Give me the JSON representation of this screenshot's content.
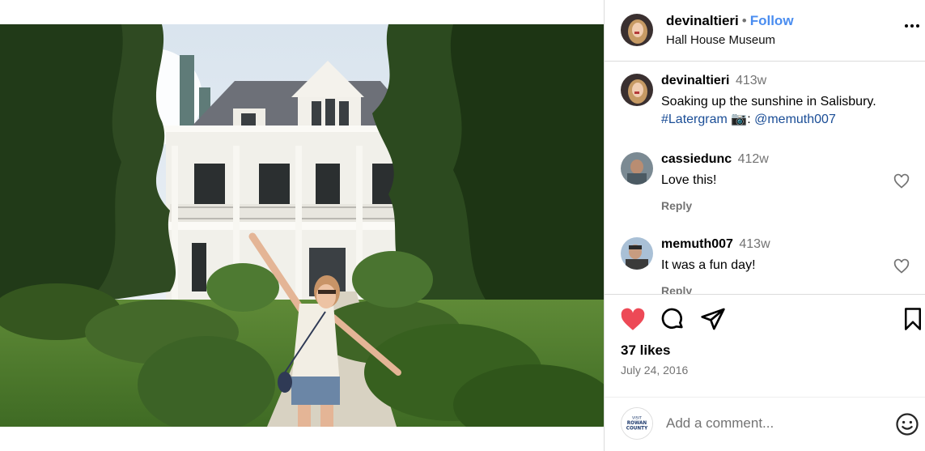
{
  "post": {
    "author": "devinaltieri",
    "follow_label": "Follow",
    "location": "Hall House Museum",
    "more_icon": "more-horizontal-icon"
  },
  "comments": [
    {
      "user": "devinaltieri",
      "time": "413w",
      "text_main": "Soaking up the sunshine in Salisbury.",
      "hashtag": "#Latergram",
      "camera_emoji": "📷",
      "colon": ":",
      "mention": "@memuth007",
      "is_caption": true
    },
    {
      "user": "cassiedunc",
      "time": "412w",
      "text": "Love this!",
      "reply": "Reply"
    },
    {
      "user": "memuth007",
      "time": "413w",
      "text": "It was a fun day!",
      "reply": "Reply"
    }
  ],
  "actions": {
    "icons": [
      "heart-filled-icon",
      "comment-icon",
      "share-icon",
      "bookmark-icon"
    ],
    "like_color": "#ed4956",
    "likes": "37 likes",
    "date": "July 24, 2016"
  },
  "add_comment": {
    "placeholder": "Add a comment...",
    "avatar_text": [
      "VISIT",
      "ROWAN",
      "COUNTY"
    ]
  }
}
